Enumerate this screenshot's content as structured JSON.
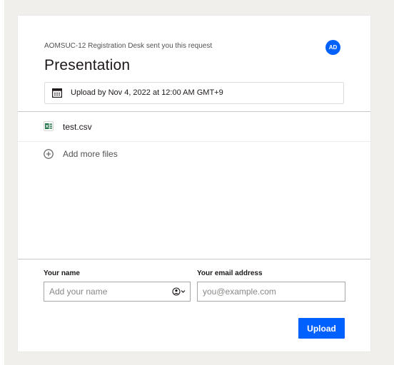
{
  "request": {
    "requester_text": "AOMSUC-12 Registration Desk sent you this request",
    "avatar_initials": "AD",
    "title": "Presentation",
    "deadline": "Upload by Nov 4, 2022 at 12:00 AM GMT+9"
  },
  "files": [
    {
      "name": "test.csv",
      "icon": "spreadsheet-file-icon"
    }
  ],
  "add_files_label": "Add more files",
  "form": {
    "name_label": "Your name",
    "name_value": "",
    "name_placeholder": "Add your name",
    "email_label": "Your email address",
    "email_value": "",
    "email_placeholder": "you@example.com"
  },
  "upload_label": "Upload",
  "colors": {
    "accent": "#0061fe",
    "background": "#f1efec",
    "card": "#ffffff",
    "spreadsheet_green": "#1e7145"
  }
}
